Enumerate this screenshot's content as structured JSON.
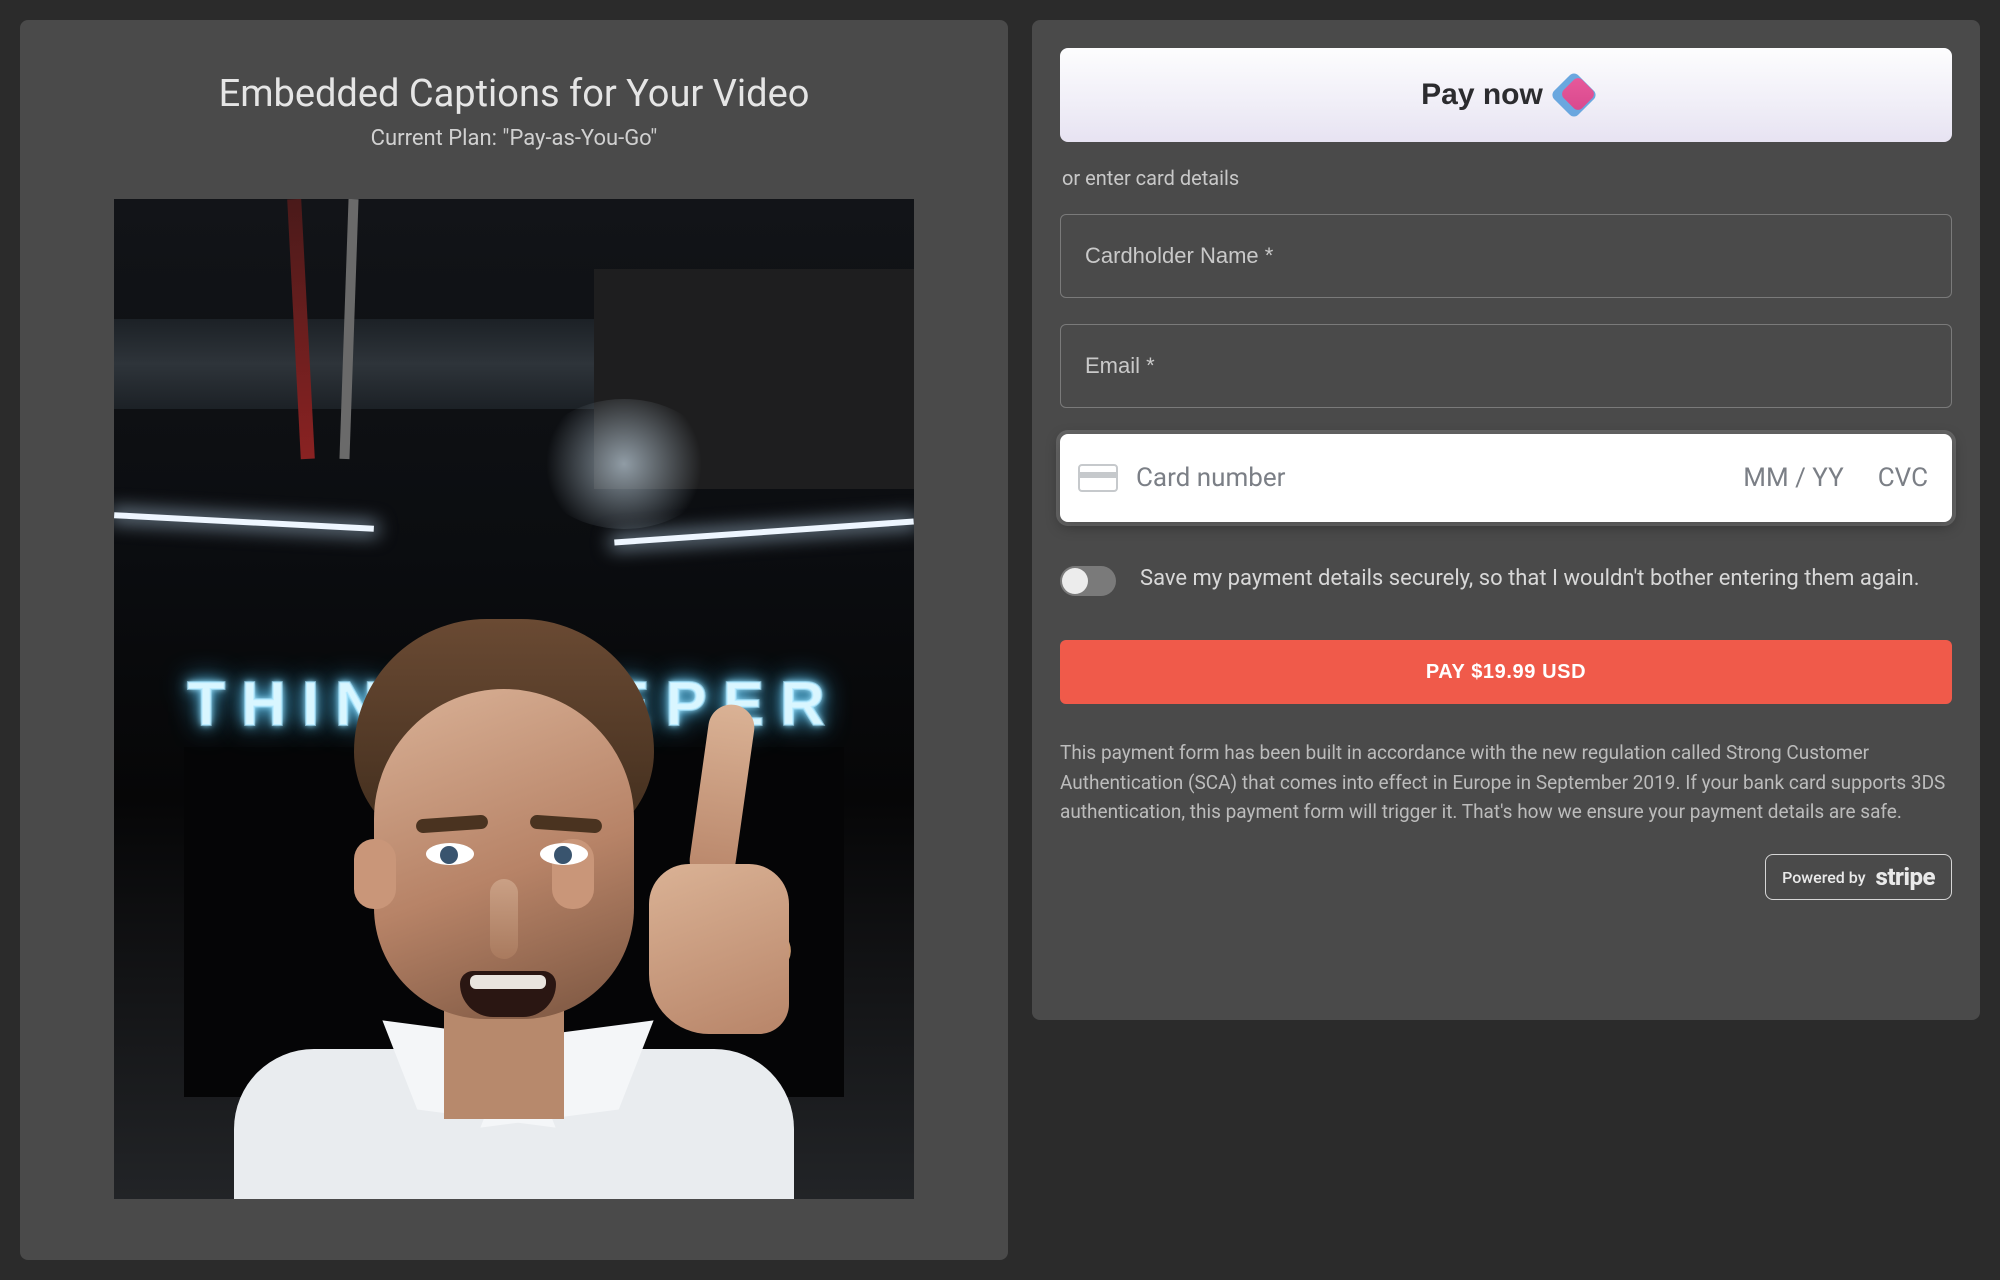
{
  "left": {
    "title": "Embedded Captions for Your Video",
    "subtitle": "Current Plan: \"Pay-as-You-Go\"",
    "neon_text": "THINK DEEPER"
  },
  "payment": {
    "pay_now_label": "Pay now",
    "or_text": "or enter card details",
    "cardholder_placeholder": "Cardholder Name *",
    "email_placeholder": "Email *",
    "card_number_placeholder": "Card number",
    "card_exp_placeholder": "MM / YY",
    "card_cvc_placeholder": "CVC",
    "save_toggle_text": "Save my payment details securely, so that I wouldn't bother entering them again.",
    "pay_button_label": "PAY $19.99 USD",
    "disclaimer": "This payment form has been built in accordance with the new regulation called Strong Customer Authentication (SCA) that comes into effect in Europe in September 2019. If your bank card supports 3DS authentication, this payment form will trigger it. That's how we ensure your payment details are safe.",
    "stripe_powered_by": "Powered by",
    "stripe_logo_text": "stripe"
  },
  "colors": {
    "accent_red": "#f05a4a",
    "panel_bg": "#4a4a4a",
    "page_bg": "#2b2b2b"
  }
}
